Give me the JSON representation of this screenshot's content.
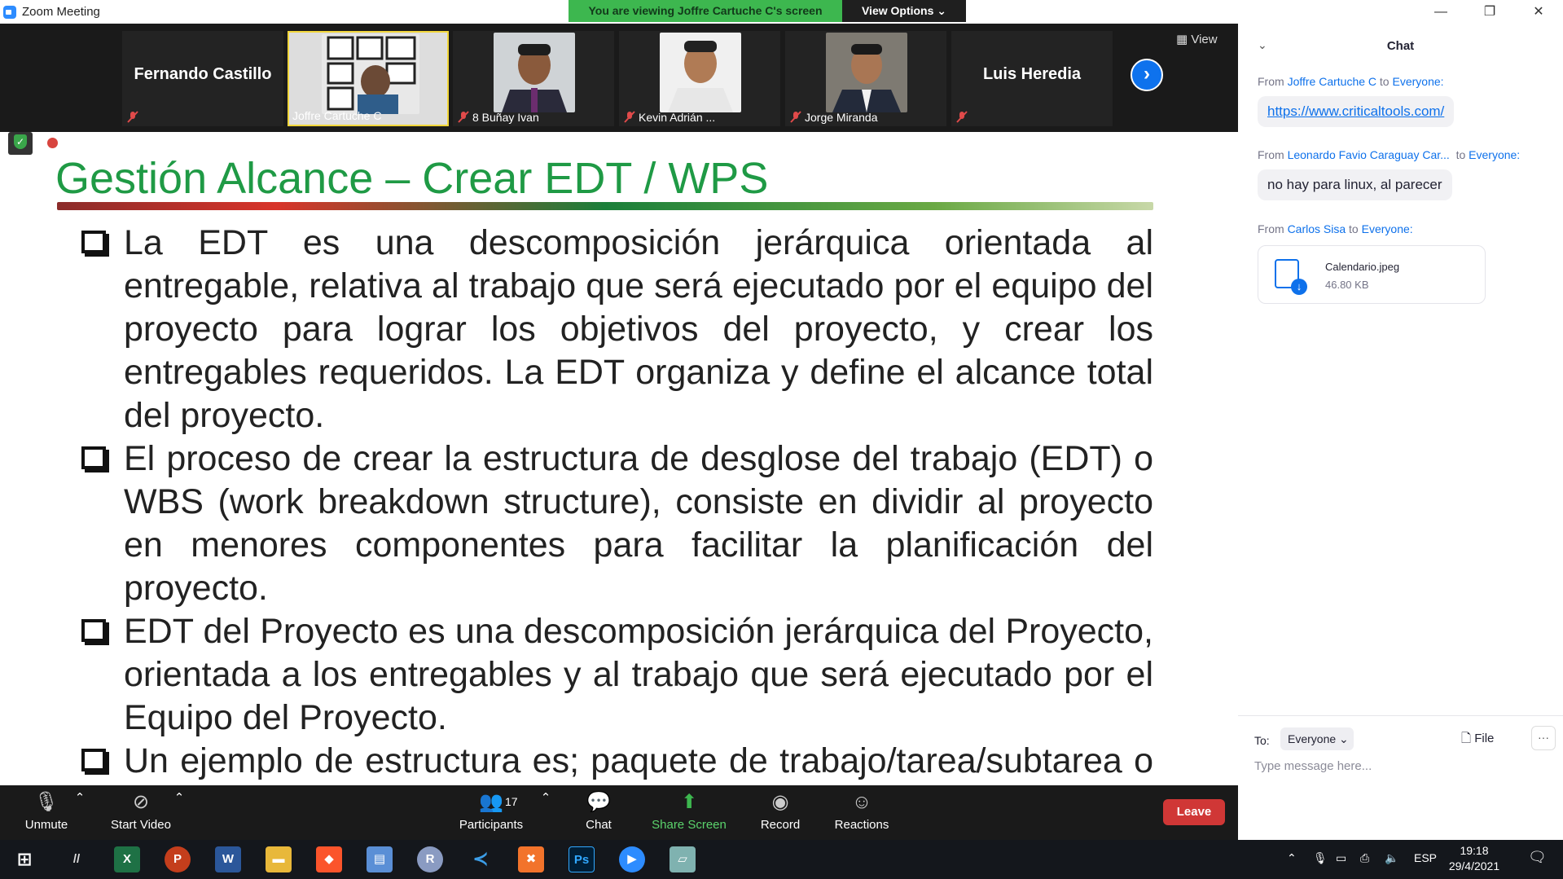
{
  "window": {
    "title": "Zoom Meeting"
  },
  "banner": {
    "viewing": "You are viewing Joffre Cartuche C's screen",
    "view_options": "View Options"
  },
  "participants_strip": {
    "tiles": [
      {
        "name": "Fernando Castillo"
      },
      {
        "name": "Joffre Cartuche C"
      },
      {
        "name": "8 Buñay Ivan"
      },
      {
        "name": "Kevin Adrián ..."
      },
      {
        "name": "Jorge Miranda"
      },
      {
        "name": "Luis Heredia"
      }
    ],
    "view_label": "View"
  },
  "slide": {
    "title": "Gestión Alcance – Crear EDT / WPS",
    "bullets": [
      "La EDT es una descomposición jerárquica orientada al entregable, relativa al trabajo que será ejecutado por el equipo del proyecto para lograr los objetivos del proyecto, y crear los entregables requeridos. La EDT organiza y define el alcance total del proyecto.",
      "El proceso de crear la estructura de desglose del trabajo (EDT) o WBS (work breakdown structure), consiste en dividir al proyecto en menores componentes para facilitar la planificación del proyecto.",
      "EDT del Proyecto es una descomposición jerárquica del Proyecto, orientada a los entregables y al trabajo que será ejecutado por el Equipo del Proyecto.",
      "Un ejemplo de estructura es; paquete de trabajo/tarea/subtarea o actividad del Proyecto"
    ]
  },
  "toolbar": {
    "unmute": "Unmute",
    "start_video": "Start Video",
    "participants": "Participants",
    "participants_count": "17",
    "chat": "Chat",
    "share_screen": "Share Screen",
    "record": "Record",
    "reactions": "Reactions",
    "leave": "Leave"
  },
  "chat": {
    "title": "Chat",
    "messages": [
      {
        "from_prefix": "From",
        "sender": "Joffre Cartuche C",
        "to_word": "to",
        "recipient": "Everyone:",
        "text": "https://www.criticaltools.com/"
      },
      {
        "from_prefix": "From",
        "sender": "Leonardo Favio Caraguay Car...",
        "to_word": "to",
        "recipient": "Everyone:",
        "text": "no hay para linux, al parecer"
      },
      {
        "from_prefix": "From",
        "sender": "Carlos Sisa",
        "to_word": "to",
        "recipient": "Everyone:",
        "file_name": "Calendario.jpeg",
        "file_size": "46.80 KB"
      }
    ],
    "to_label": "To:",
    "to_value": "Everyone",
    "file_label": "File",
    "more_label": "···",
    "input_placeholder": "Type message here..."
  },
  "taskbar": {
    "lang": "ESP",
    "time": "19:18",
    "date": "29/4/2021"
  },
  "colors": {
    "banner_green": "#3db74f",
    "zoom_blue": "#0e71eb",
    "slide_title_green": "#1f9a45",
    "leave_red": "#d03736"
  }
}
